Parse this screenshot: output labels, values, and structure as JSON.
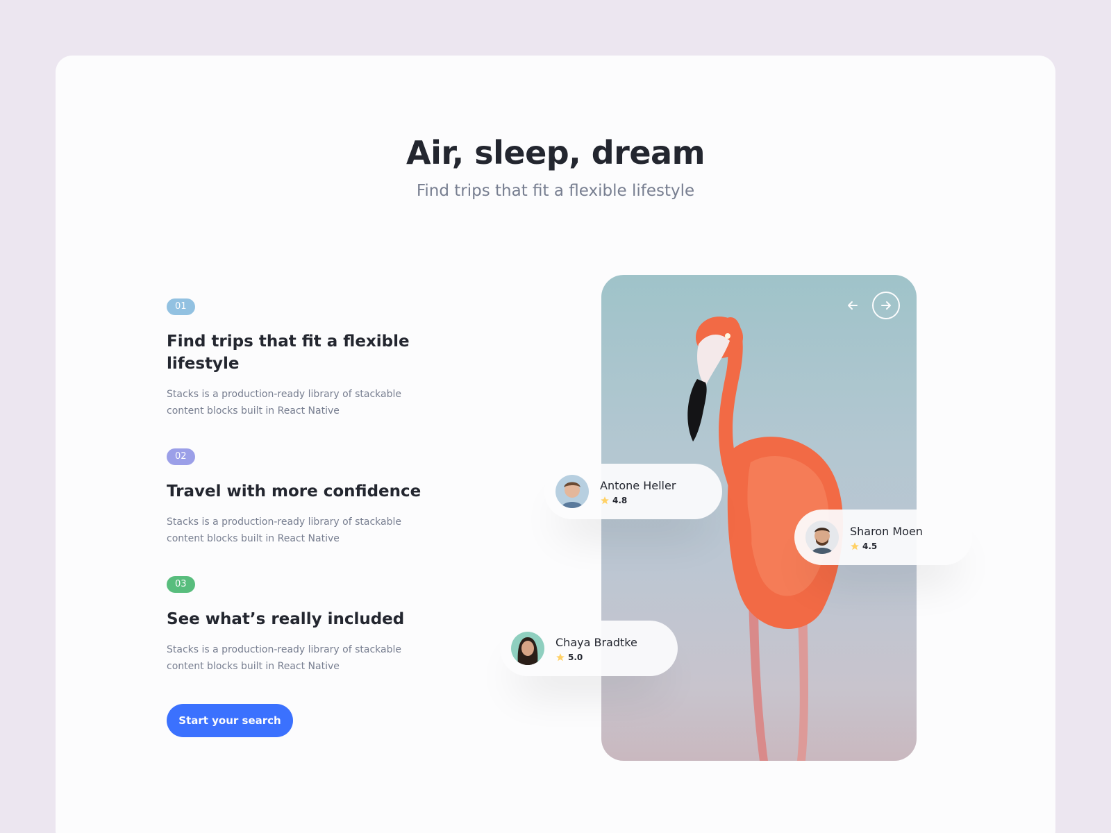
{
  "hero": {
    "title": "Air, sleep, dream",
    "subtitle": "Find trips that fit a flexible lifestyle"
  },
  "steps": [
    {
      "badge": "01",
      "badge_color": "#92c1e1",
      "title": "Find trips that fit a flexible lifestyle",
      "text": "Stacks is a production-ready library of stackable content blocks built in React Native"
    },
    {
      "badge": "02",
      "badge_color": "#9b9fe8",
      "title": "Travel with more confidence",
      "text": "Stacks is a production-ready library of stackable content blocks built in React Native"
    },
    {
      "badge": "03",
      "badge_color": "#58bd7d",
      "title": "See what’s really included",
      "text": "Stacks is a production-ready library of stackable content blocks built in React Native"
    }
  ],
  "cta": {
    "label": "Start your search",
    "color": "#3b71fe"
  },
  "carousel": {
    "prev_icon": "arrow-left-icon",
    "next_icon": "arrow-right-icon"
  },
  "reviews": [
    {
      "name": "Antone Heller",
      "rating": "4.8"
    },
    {
      "name": "Sharon Moen",
      "rating": "4.5"
    },
    {
      "name": "Chaya Bradtke",
      "rating": "5.0"
    }
  ],
  "colors": {
    "background": "#ece6f0",
    "card": "#fcfcfd",
    "star": "#ffd166",
    "flamingo": "#f2603f"
  }
}
